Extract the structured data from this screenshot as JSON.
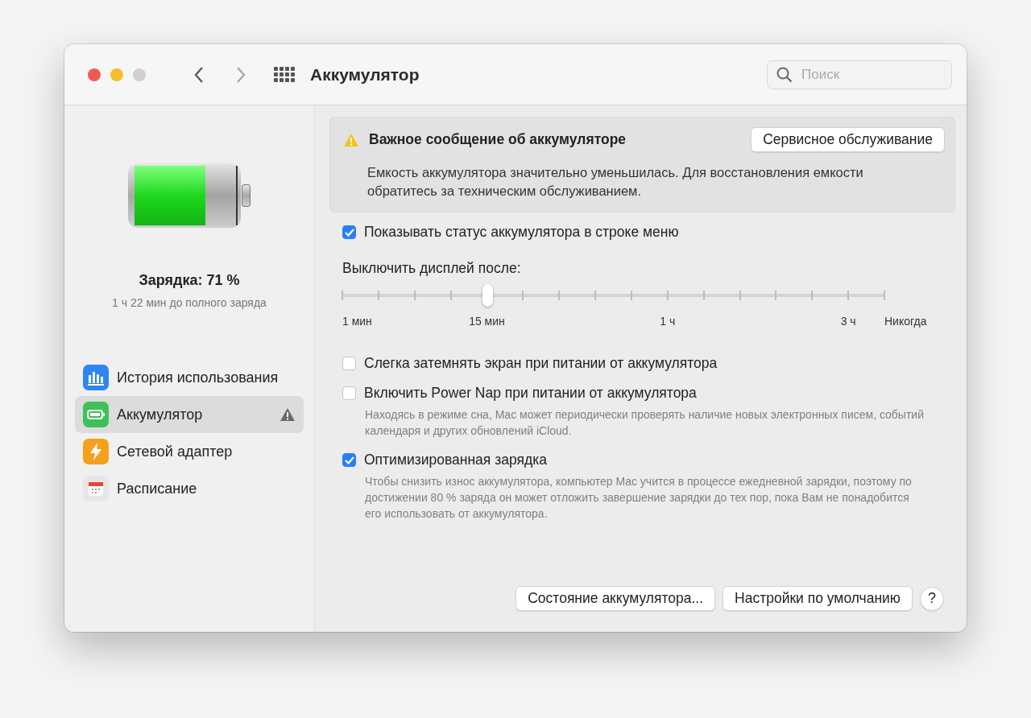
{
  "window": {
    "title": "Аккумулятор",
    "search": {
      "placeholder": "Поиск"
    }
  },
  "sidebar": {
    "battery": {
      "level": 0.71
    },
    "charge_title": "Зарядка: 71 %",
    "charge_subtitle": "1 ч 22 мин до полного заряда",
    "items": [
      {
        "kind": "history",
        "label": "История использования",
        "selected": false,
        "warning": false
      },
      {
        "kind": "battery",
        "label": "Аккумулятор",
        "selected": true,
        "warning": true
      },
      {
        "kind": "adapter",
        "label": "Сетевой адаптер",
        "selected": false,
        "warning": false
      },
      {
        "kind": "schedule",
        "label": "Расписание",
        "selected": false,
        "warning": false
      }
    ]
  },
  "alert": {
    "title": "Важное сообщение об аккумуляторе",
    "button": "Сервисное обслуживание",
    "text": "Емкость аккумулятора значительно уменьшилась. Для восстановления емкости обратитесь за техническим обслуживанием."
  },
  "options": [
    {
      "kind": "checkbox",
      "label": "Показывать статус аккумулятора в строке меню",
      "checked": true
    },
    {
      "kind": "slider",
      "label": "Выключить дисплей после:",
      "level": 0.267,
      "ticks": [
        {
          "kind": "labeled",
          "label": "1 мин"
        },
        {
          "kind": "plain"
        },
        {
          "kind": "plain"
        },
        {
          "kind": "plain"
        },
        {
          "kind": "labeled",
          "label": "15 мин"
        },
        {
          "kind": "plain"
        },
        {
          "kind": "plain"
        },
        {
          "kind": "plain"
        },
        {
          "kind": "plain"
        },
        {
          "kind": "labeled",
          "label": "1 ч"
        },
        {
          "kind": "plain"
        },
        {
          "kind": "plain"
        },
        {
          "kind": "plain"
        },
        {
          "kind": "plain"
        },
        {
          "kind": "labeled",
          "label": "3 ч"
        },
        {
          "kind": "labeled",
          "label": "Никогда"
        }
      ]
    },
    {
      "kind": "checkbox",
      "label": "Слегка затемнять экран при питании от аккумулятора",
      "checked": false
    },
    {
      "kind": "checkbox",
      "label": "Включить Power Nap при питании от аккумулятора",
      "checked": false,
      "description": "Находясь в режиме сна, Mac может периодически проверять наличие новых электронных писем, событий календаря и других обновлений iCloud."
    },
    {
      "kind": "checkbox",
      "label": "Оптимизированная зарядка",
      "checked": true,
      "description": "Чтобы снизить износ аккумулятора, компьютер Mac учится в процессе ежедневной зарядки, поэтому по достижении 80 % заряда он может отложить завершение зарядки до тех пор, пока Вам не понадобится его использовать от аккумулятора."
    }
  ],
  "buttons": [
    {
      "kind": "text",
      "label": "Состояние аккумулятора..."
    },
    {
      "kind": "text",
      "label": "Настройки по умолчанию"
    },
    {
      "kind": "help",
      "label": "?"
    }
  ]
}
